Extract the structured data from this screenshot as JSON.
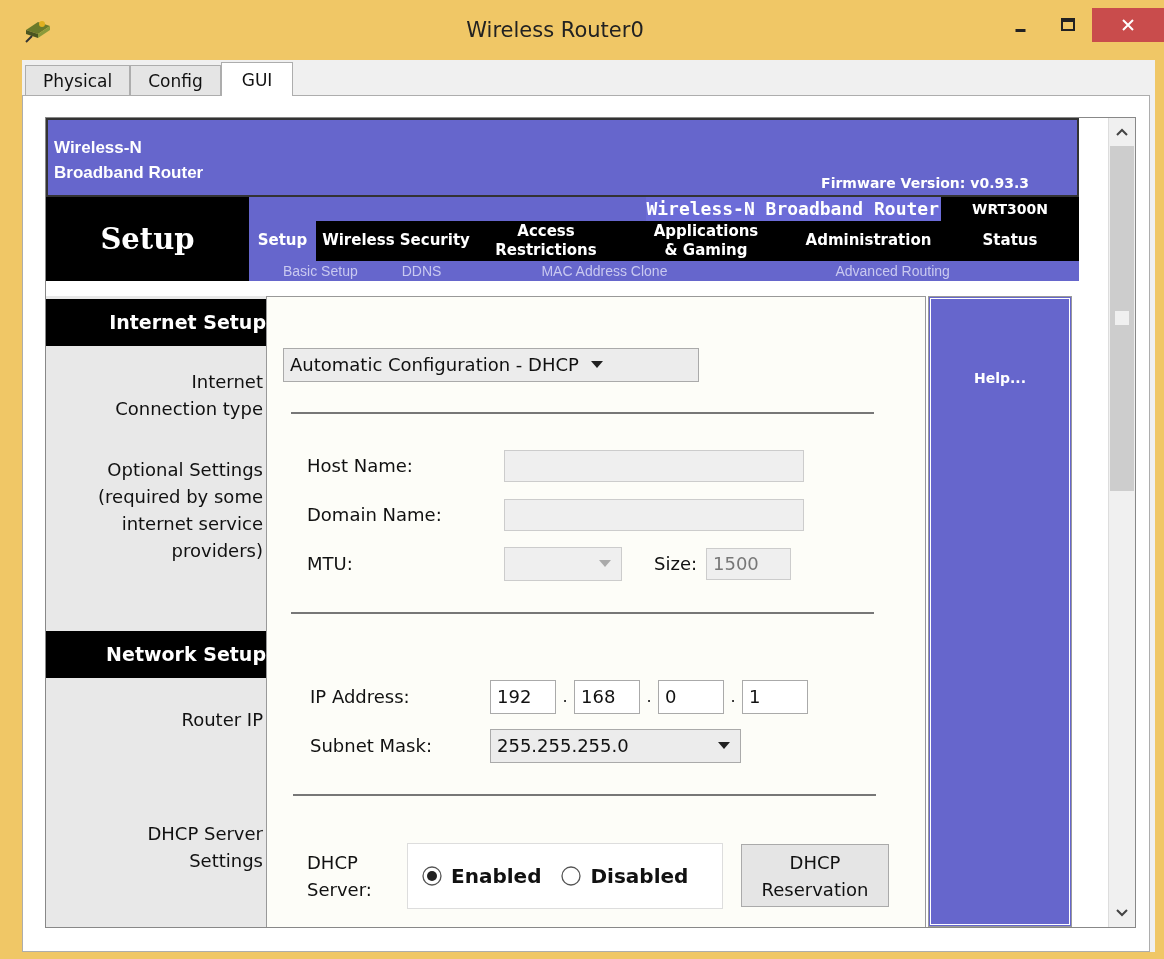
{
  "window": {
    "title": "Wireless Router0"
  },
  "tabs": [
    {
      "label": "Physical",
      "selected": false
    },
    {
      "label": "Config",
      "selected": false
    },
    {
      "label": "GUI",
      "selected": true
    }
  ],
  "router": {
    "brand": "Wireless-N\nBroadband Router",
    "firmware": "Firmware Version: v0.93.3",
    "page_title": "Setup",
    "product": "Wireless-N Broadband Router",
    "model": "WRT300N",
    "nav": [
      {
        "label": "Setup",
        "selected": true
      },
      {
        "label": "Wireless Security",
        "selected": false
      },
      {
        "label": "Access\nRestrictions",
        "selected": false
      },
      {
        "label": "Applications\n& Gaming",
        "selected": false
      },
      {
        "label": "Administration",
        "selected": false
      },
      {
        "label": "Status",
        "selected": false
      }
    ],
    "subnav": [
      "Basic Setup",
      "DDNS",
      "MAC Address Clone",
      "Advanced Routing"
    ]
  },
  "sections": [
    {
      "heading": "Internet Setup",
      "labels": [
        "Internet\nConnection type",
        "Optional Settings\n(required by some\ninternet service\nproviders)"
      ]
    },
    {
      "heading": "Network Setup",
      "labels": [
        "Router IP"
      ]
    },
    {
      "labels": [
        "DHCP Server\nSettings"
      ]
    }
  ],
  "internet": {
    "connection_type": "Automatic Configuration - DHCP",
    "host_name": {
      "label": "Host Name:",
      "disabled": true
    },
    "domain_name": {
      "label": "Domain Name:",
      "disabled": true
    },
    "mtu": {
      "label": "MTU:",
      "disabled": true
    },
    "size": {
      "label": "Size:",
      "value": "1500",
      "disabled": true
    }
  },
  "network": {
    "ip": {
      "label": "IP Address:",
      "separator": ".",
      "octets": [
        "192",
        "168",
        "0",
        "1"
      ]
    },
    "subnet": {
      "label": "Subnet Mask:",
      "value": "255.255.255.0"
    }
  },
  "dhcp": {
    "label": "DHCP\nServer:",
    "options": [
      {
        "label": "Enabled",
        "selected": true
      },
      {
        "label": "Disabled",
        "selected": false
      }
    ],
    "button": "DHCP\nReservation"
  },
  "help": "Help..."
}
